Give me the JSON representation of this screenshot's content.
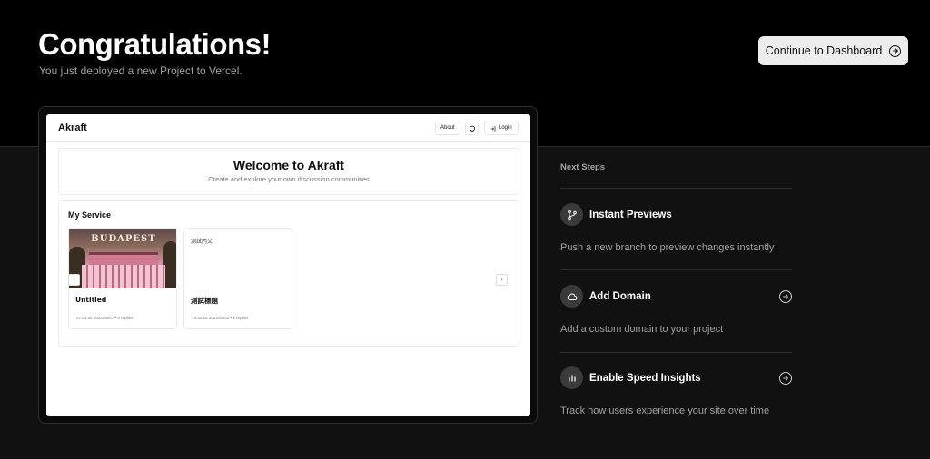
{
  "header": {
    "title": "Congratulations!",
    "subtitle": "You just deployed a new Project to Vercel.",
    "continue_label": "Continue to Dashboard"
  },
  "preview": {
    "logo": "Akraft",
    "nav_about": "About",
    "nav_login": "Login",
    "hero_title": "Welcome to Akraft",
    "hero_subtitle": "Create and explore your own discussion communities",
    "section_title": "My Service",
    "cards": [
      {
        "thumb_text": "BUDAPEST",
        "title": "Untitled",
        "meta": "07:04:52 2024/09/07  •  0 replies"
      },
      {
        "top_text": "測試內文",
        "title": "測試標題",
        "meta": "14:42:18 2024/08/31  •  1 replies"
      }
    ]
  },
  "next_steps": {
    "title": "Next Steps",
    "items": [
      {
        "icon": "git-branch-icon",
        "title": "Instant Previews",
        "desc": "Push a new branch to preview changes instantly",
        "has_arrow": false
      },
      {
        "icon": "cloud-icon",
        "title": "Add Domain",
        "desc": "Add a custom domain to your project",
        "has_arrow": true
      },
      {
        "icon": "bar-chart-icon",
        "title": "Enable Speed Insights",
        "desc": "Track how users experience your site over time",
        "has_arrow": true
      }
    ]
  },
  "colors": {
    "background": "#111111",
    "header_background": "#000000",
    "button_background": "#ededed"
  }
}
